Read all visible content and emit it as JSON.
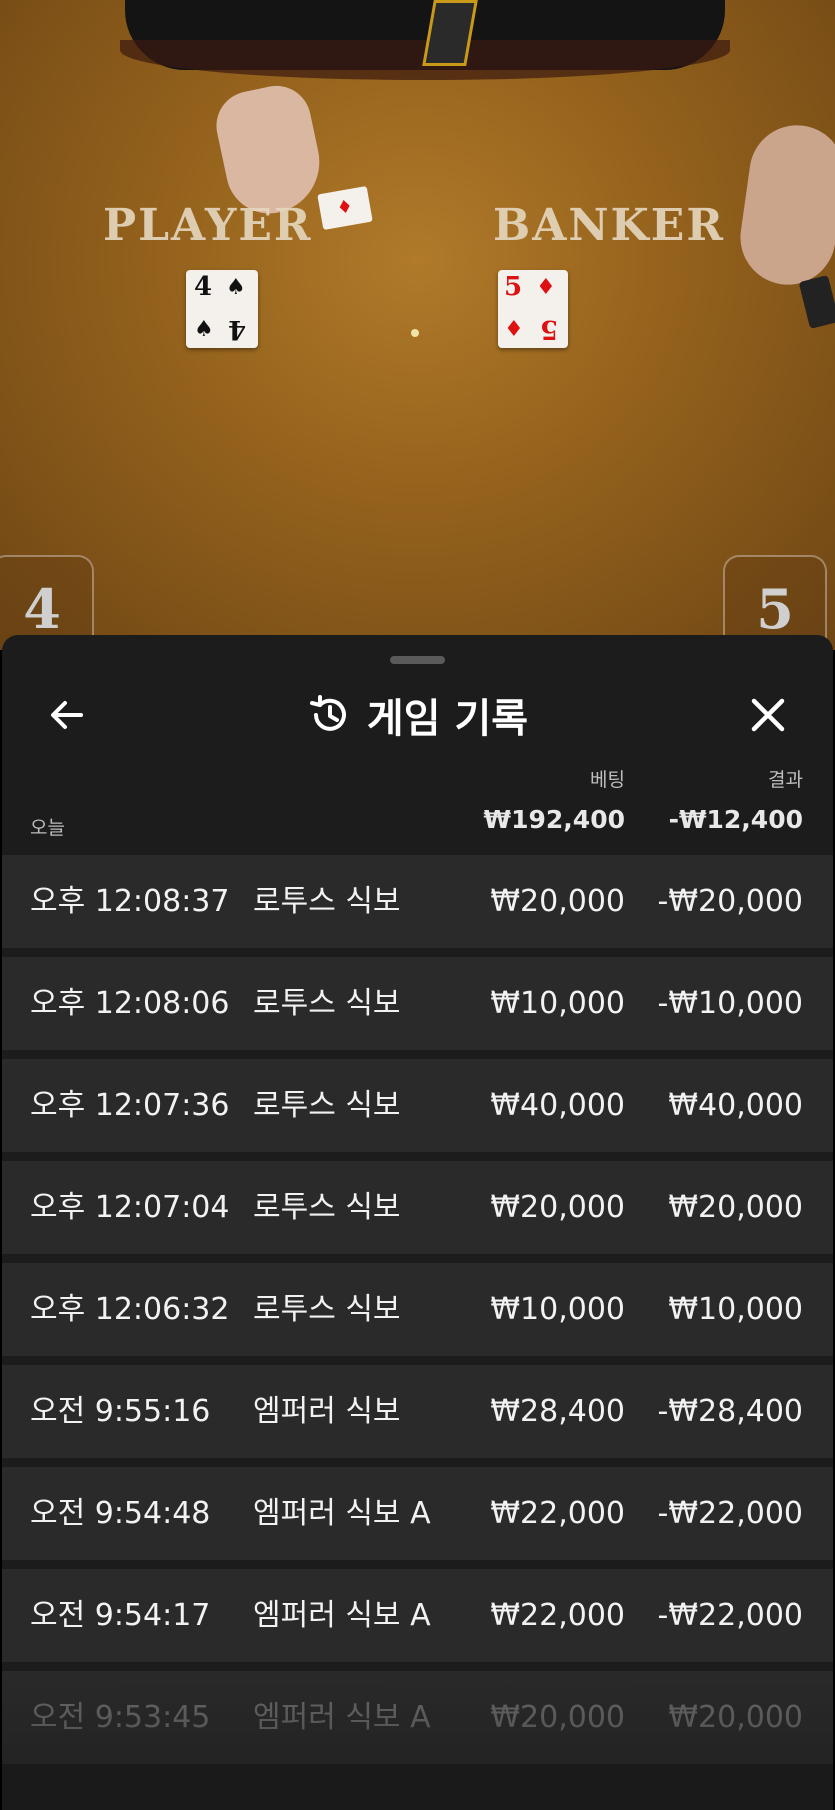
{
  "game": {
    "player_label": "PLAYER",
    "banker_label": "BANKER",
    "player_card": {
      "rank": "4",
      "suit": "♠"
    },
    "banker_card": {
      "rank": "5",
      "suit": "♦"
    },
    "player_score": "4",
    "banker_score": "5"
  },
  "history": {
    "title": "게임 기록",
    "back_icon": "arrow-left-icon",
    "history_icon": "history-clock-icon",
    "close_icon": "close-icon",
    "col_bet": "베팅",
    "col_result": "결과",
    "group_label": "오늘",
    "total_bet": "₩192,400",
    "total_result": "-₩12,400",
    "rows": [
      {
        "time": "오후 12:08:37",
        "game": "로투스 식보",
        "bet": "₩20,000",
        "result": "-₩20,000"
      },
      {
        "time": "오후 12:08:06",
        "game": "로투스 식보",
        "bet": "₩10,000",
        "result": "-₩10,000"
      },
      {
        "time": "오후 12:07:36",
        "game": "로투스 식보",
        "bet": "₩40,000",
        "result": "₩40,000"
      },
      {
        "time": "오후 12:07:04",
        "game": "로투스 식보",
        "bet": "₩20,000",
        "result": "₩20,000"
      },
      {
        "time": "오후 12:06:32",
        "game": "로투스 식보",
        "bet": "₩10,000",
        "result": "₩10,000"
      },
      {
        "time": "오전 9:55:16",
        "game": "엠퍼러 식보",
        "bet": "₩28,400",
        "result": "-₩28,400"
      },
      {
        "time": "오전 9:54:48",
        "game": "엠퍼러 식보 A",
        "bet": "₩22,000",
        "result": "-₩22,000"
      },
      {
        "time": "오전 9:54:17",
        "game": "엠퍼러 식보 A",
        "bet": "₩22,000",
        "result": "-₩22,000"
      },
      {
        "time": "오전 9:53:45",
        "game": "엠퍼러 식보 A",
        "bet": "₩20,000",
        "result": "₩20,000"
      }
    ]
  }
}
